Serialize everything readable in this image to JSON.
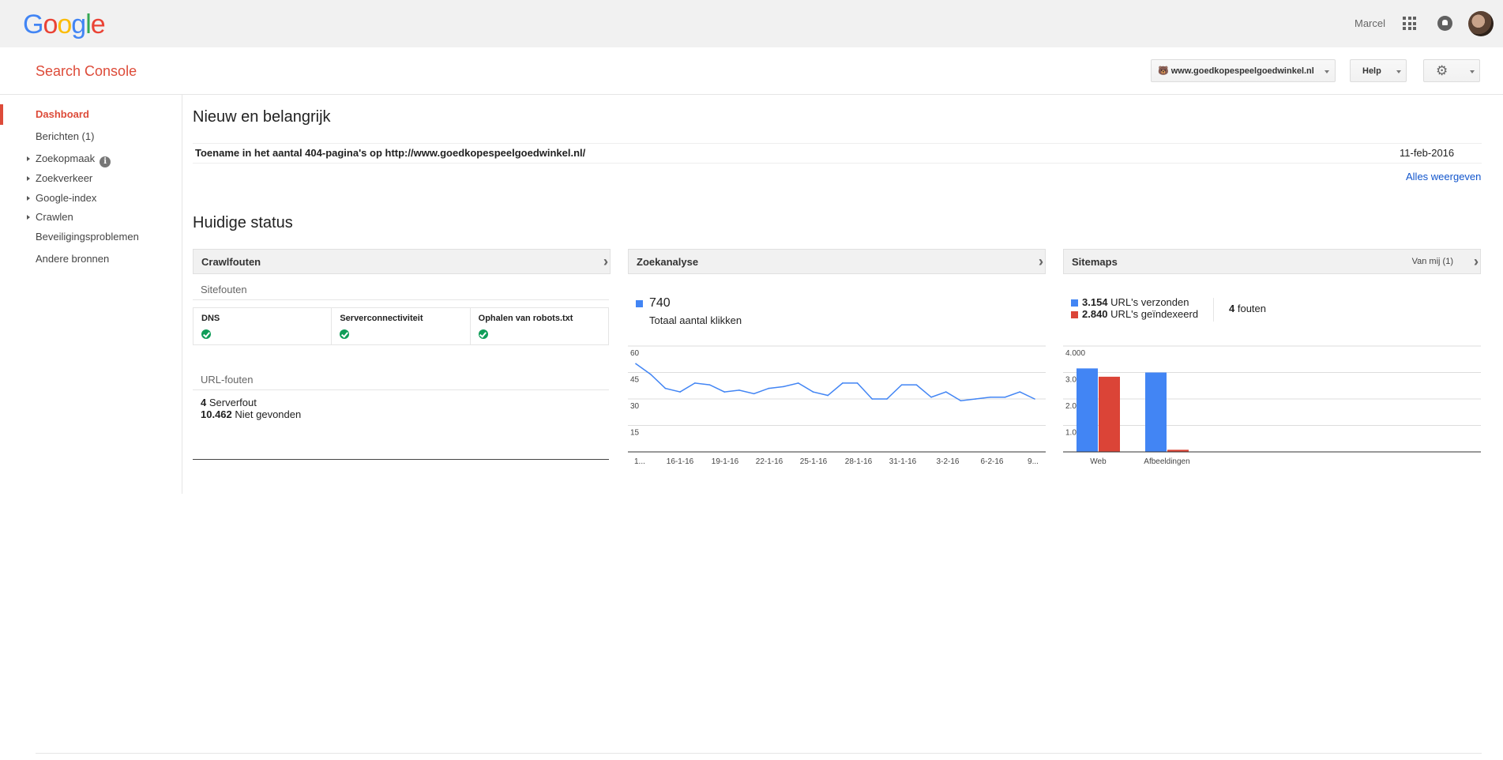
{
  "header": {
    "logo_letters": [
      {
        "ch": "G",
        "color": "#4285f4"
      },
      {
        "ch": "o",
        "color": "#ea4335"
      },
      {
        "ch": "o",
        "color": "#fbbc05"
      },
      {
        "ch": "g",
        "color": "#4285f4"
      },
      {
        "ch": "l",
        "color": "#34a853"
      },
      {
        "ch": "e",
        "color": "#ea4335"
      }
    ],
    "user_name": "Marcel"
  },
  "subheader": {
    "product_title": "Search Console",
    "site": "www.goedkopespeelgoedwinkel.nl",
    "help_label": "Help"
  },
  "sidebar": {
    "items": [
      {
        "label": "Dashboard",
        "active": true,
        "expandable": false
      },
      {
        "label": "Berichten (1)",
        "active": false,
        "expandable": false
      },
      {
        "label": "Zoekopmaak",
        "active": false,
        "expandable": true,
        "info": true
      },
      {
        "label": "Zoekverkeer",
        "active": false,
        "expandable": true
      },
      {
        "label": "Google-index",
        "active": false,
        "expandable": true
      },
      {
        "label": "Crawlen",
        "active": false,
        "expandable": true
      },
      {
        "label": "Beveiligingsproblemen",
        "active": false,
        "expandable": false
      },
      {
        "label": "Andere bronnen",
        "active": false,
        "expandable": false
      }
    ],
    "info_glyph": "i"
  },
  "new_section": {
    "title": "Nieuw en belangrijk",
    "message": "Toename in het aantal 404-pagina's op http://www.goedkopespeelgoedwinkel.nl/",
    "date": "11-feb-2016",
    "view_all": "Alles weergeven"
  },
  "status_section": {
    "title": "Huidige status"
  },
  "crawl_panel": {
    "title": "Crawlfouten",
    "site_errors_label": "Sitefouten",
    "checks": [
      "DNS",
      "Serverconnectiviteit",
      "Ophalen van robots.txt"
    ],
    "url_errors_label": "URL-fouten",
    "url_errors": [
      {
        "count": "4",
        "label": "Serverfout"
      },
      {
        "count": "10.462",
        "label": "Niet gevonden"
      }
    ]
  },
  "search_panel": {
    "title": "Zoekanalyse",
    "total": "740",
    "total_label": "Totaal aantal klikken",
    "series_color": "#4285f4"
  },
  "sitemaps_panel": {
    "title": "Sitemaps",
    "owner_filter": "Van mij (1)",
    "submitted_count": "3.154",
    "submitted_label": "URL's verzonden",
    "indexed_count": "2.840",
    "indexed_label": "URL's geïndexeerd",
    "errors_count": "4",
    "errors_label": "fouten",
    "submitted_color": "#4285f4",
    "indexed_color": "#db4437"
  },
  "chart_data": [
    {
      "type": "line",
      "series": [
        {
          "values": [
            50,
            44,
            36,
            34,
            39,
            38,
            34,
            35,
            33,
            36,
            37,
            39,
            34,
            32,
            39,
            39,
            30,
            30,
            38,
            38,
            31,
            34,
            29,
            30,
            31,
            31,
            34,
            30
          ]
        }
      ],
      "x_tick_labels": [
        "1...",
        "16-1-16",
        "19-1-16",
        "22-1-16",
        "25-1-16",
        "28-1-16",
        "31-1-16",
        "3-2-16",
        "6-2-16",
        "9..."
      ],
      "y_tick_labels": [
        "60",
        "45",
        "30",
        "15"
      ],
      "ylim": [
        0,
        60
      ],
      "grid": true
    },
    {
      "type": "bar",
      "categories": [
        "Web",
        "Afbeeldingen"
      ],
      "series": [
        {
          "name": "URL's verzonden",
          "values": [
            3154,
            3000
          ]
        },
        {
          "name": "URL's geïndexeerd",
          "values": [
            2840,
            80
          ]
        }
      ],
      "y_tick_labels": [
        "4.000",
        "3.000",
        "2.000",
        "1.000"
      ],
      "ylim": [
        0,
        4000
      ],
      "grid": true
    }
  ]
}
